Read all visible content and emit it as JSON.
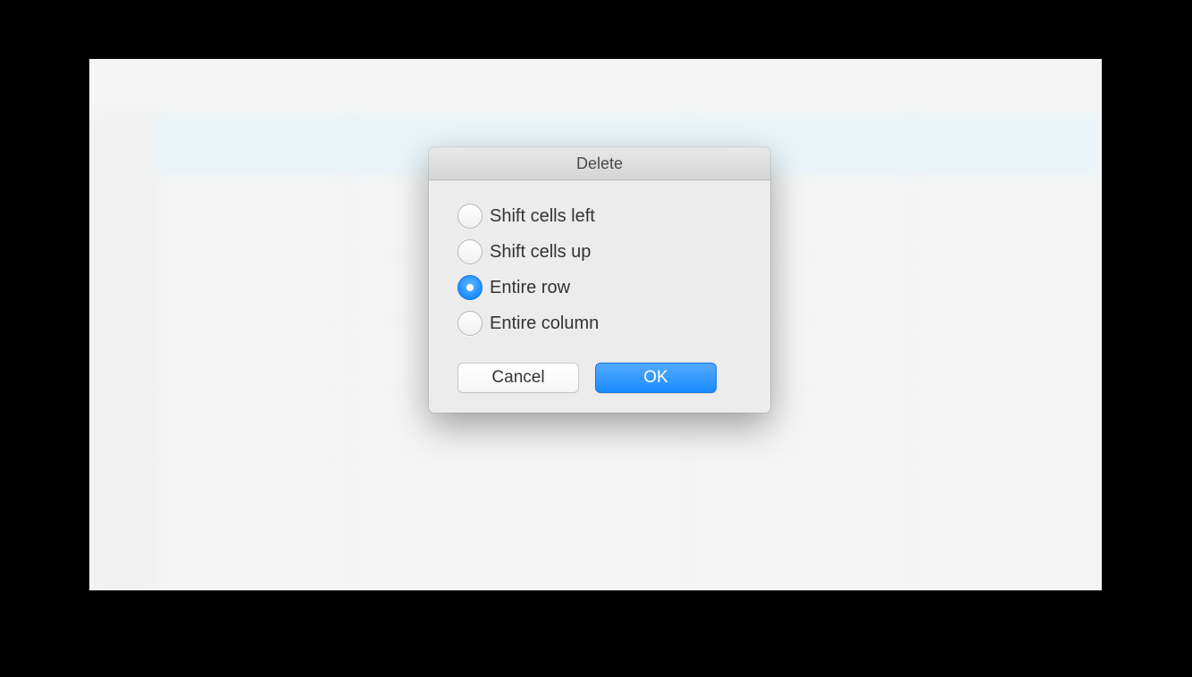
{
  "dialog": {
    "title": "Delete",
    "options": [
      {
        "label": "Shift cells left",
        "selected": false
      },
      {
        "label": "Shift cells up",
        "selected": false
      },
      {
        "label": "Entire row",
        "selected": true
      },
      {
        "label": "Entire column",
        "selected": false
      }
    ],
    "buttons": {
      "cancel": "Cancel",
      "ok": "OK"
    }
  }
}
